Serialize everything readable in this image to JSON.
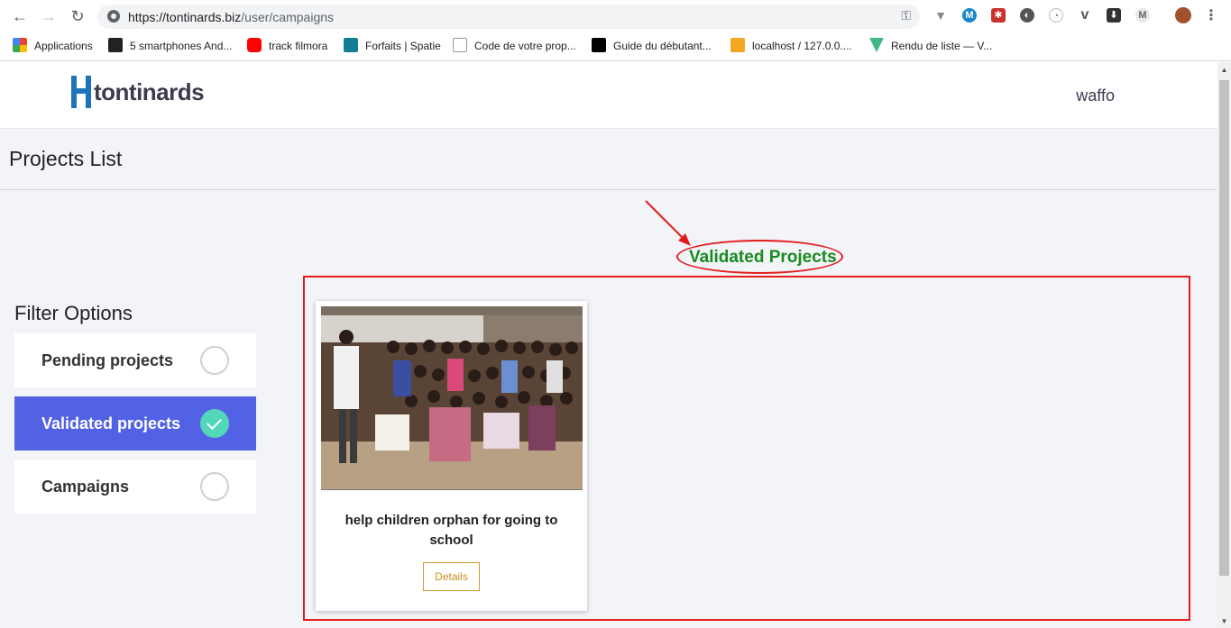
{
  "browser": {
    "url_host": "https://tontinards.biz",
    "url_path": "/user/campaigns",
    "bookmarks": [
      {
        "label": "Applications",
        "color": "#ea4335"
      },
      {
        "label": "5 smartphones And...",
        "color": "#222222"
      },
      {
        "label": "track filmora",
        "color": "#ff0000"
      },
      {
        "label": "Forfaits | Spatie",
        "color": "#137e91"
      },
      {
        "label": "Code de votre prop...",
        "color": "#ffffff"
      },
      {
        "label": "Guide du débutant...",
        "color": "#000000"
      },
      {
        "label": "localhost / 127.0.0....",
        "color": "#f5a623"
      },
      {
        "label": "Rendu de liste — V...",
        "color": "#41b883"
      }
    ],
    "extension_icons": [
      "vivaldi-icon",
      "m-icon",
      "puzzle-icon",
      "circle-icon",
      "timer-icon",
      "vimeo-icon",
      "download-icon",
      "m2-icon",
      "profile-avatar"
    ]
  },
  "header": {
    "logo_text": "tontinards",
    "username": "waffo"
  },
  "page": {
    "title": "Projects List",
    "section_title": "Validated Projects"
  },
  "filters": {
    "title": "Filter Options",
    "items": [
      {
        "label": "Pending projects",
        "active": false
      },
      {
        "label": "Validated projects",
        "active": true
      },
      {
        "label": "Campaigns",
        "active": false
      }
    ]
  },
  "projects": [
    {
      "name": "help children orphan for going to school",
      "button": "Details"
    }
  ],
  "colors": {
    "accent": "#5362e5",
    "check": "#52d7b8",
    "section_title": "#178a1f",
    "annotation": "#e31b1b",
    "details": "#c98f1f"
  }
}
